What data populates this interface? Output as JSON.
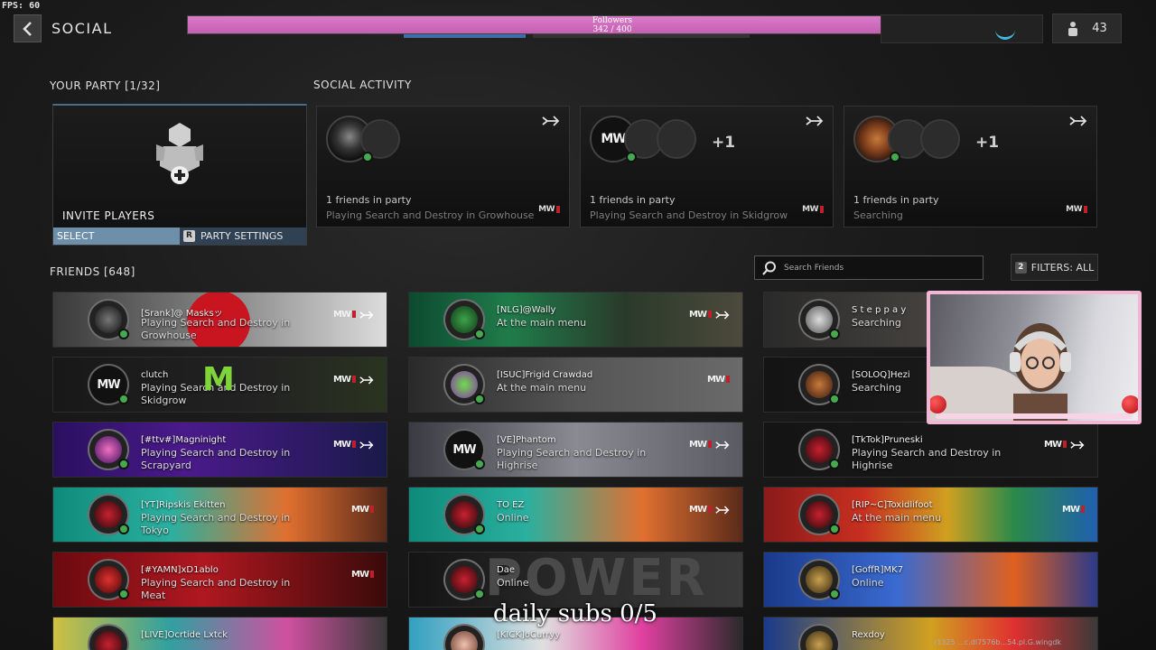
{
  "fps": "FPS: 60",
  "header": {
    "title": "SOCIAL",
    "followers_label": "Followers",
    "followers_count": "342 / 400",
    "followers_progress": 0.855,
    "player_count": "43"
  },
  "party": {
    "label": "YOUR PARTY [1/32]",
    "invite_label": "INVITE PLAYERS",
    "select_label": "SELECT",
    "settings_key": "R",
    "settings_label": "PARTY SETTINGS"
  },
  "activity": {
    "label": "SOCIAL ACTIVITY",
    "cards": [
      {
        "extra": "",
        "count": "1 friends in party",
        "status": "Playing Search and Destroy in Growhouse"
      },
      {
        "extra": "+1",
        "count": "1 friends in party",
        "status": "Playing Search and Destroy in Skidgrow"
      },
      {
        "extra": "+1",
        "count": "1 friends in party",
        "status": "Searching"
      }
    ]
  },
  "friends": {
    "label": "FRIENDS [648]",
    "search_placeholder": "Search Friends",
    "filter_key": "2",
    "filter_label": "FILTERS: ALL",
    "list": [
      {
        "name": "[Srank]@ Masksッ",
        "line1": "Playing Search and Destroy in",
        "line2": "Growhouse"
      },
      {
        "name": "[NLG]@Wally",
        "line1": "At the main menu",
        "line2": ""
      },
      {
        "name": "S t e p p a y",
        "line1": "Searching",
        "line2": ""
      },
      {
        "name": "clutch",
        "line1": "Playing Search and Destroy in",
        "line2": "Skidgrow"
      },
      {
        "name": "[ISUC]Frigid Crawdad",
        "line1": "At the main menu",
        "line2": ""
      },
      {
        "name": "[SOLOQ]Hezi",
        "line1": "Searching",
        "line2": ""
      },
      {
        "name": "[#ttv#]Magninight",
        "line1": "Playing Search and Destroy in",
        "line2": "Scrapyard"
      },
      {
        "name": "[VE]Phantom",
        "line1": "Playing Search and Destroy in",
        "line2": "Highrise"
      },
      {
        "name": "[TkTok]Pruneski",
        "line1": "Playing Search and Destroy in",
        "line2": "Highrise"
      },
      {
        "name": "[YT]Ripskis Ekitten",
        "line1": "Playing Search and Destroy in",
        "line2": "Tokyo"
      },
      {
        "name": "TO EZ",
        "line1": "Online",
        "line2": ""
      },
      {
        "name": "[RIP~C]Toxidlifoot",
        "line1": "At the main menu",
        "line2": ""
      },
      {
        "name": "[#YAMN]xD1ablo",
        "line1": "Playing Search and Destroy in",
        "line2": "Meat"
      },
      {
        "name": "Dae",
        "line1": "Online",
        "line2": ""
      },
      {
        "name": "[GoffR]MK7",
        "line1": "Online",
        "line2": ""
      },
      {
        "name": "[LIVE]Ocrtide Lxtck",
        "line1": "",
        "line2": ""
      },
      {
        "name": "[KICK]oCurryy",
        "line1": "",
        "line2": ""
      },
      {
        "name": "Rexdoy",
        "line1": "",
        "line2": ""
      }
    ]
  },
  "overlay": {
    "daily_subs": "daily subs 0/5",
    "url": "r1325 ...c.dl7576b...54.pl.G.wingdk"
  },
  "colors": {
    "followers_fill": "#c45fb2",
    "online": "#47a94e",
    "accent_blue": "#6e8faa",
    "webcam_border": "#f3b7d6"
  }
}
